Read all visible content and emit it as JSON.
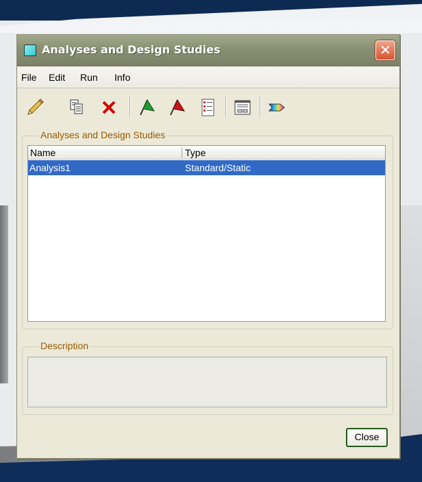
{
  "window": {
    "title": "Analyses and Design Studies",
    "close_icon": "close-x-icon"
  },
  "menu": {
    "items": [
      "File",
      "Edit",
      "Run",
      "Info"
    ]
  },
  "toolbar": {
    "icons": [
      "pencil-icon",
      "copy-icon",
      "delete-icon",
      "start-flag-icon",
      "stop-flag-icon",
      "list-icon",
      "display-icon",
      "results-icon"
    ]
  },
  "analyses_group": {
    "legend": "Analyses and Design Studies",
    "columns": [
      "Name",
      "Type"
    ],
    "rows": [
      {
        "name": "Analysis1",
        "type": "Standard/Static",
        "selected": true
      }
    ]
  },
  "description_group": {
    "legend": "Description",
    "value": ""
  },
  "footer": {
    "close_label": "Close"
  },
  "colors": {
    "selection": "#316ac5",
    "legend_text": "#995a00",
    "titlebar": "#8a9073"
  }
}
